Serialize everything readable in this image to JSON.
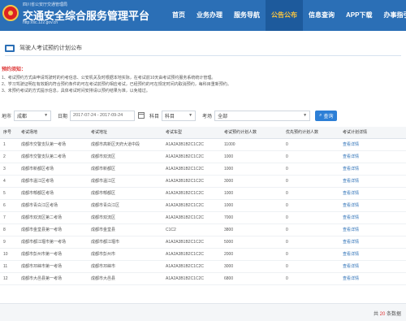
{
  "header": {
    "org_line": "四川省公安厅交通管理局",
    "site_title": "交通安全综合服务管理平台",
    "url": "http://sc.122.gov.cn",
    "nav": [
      "首页",
      "业务办理",
      "服务导航",
      "公告公布",
      "信息查询",
      "APP下载",
      "办事指引"
    ],
    "active_nav_index": 3
  },
  "section": {
    "title": "驾驶人考试预约计划公布"
  },
  "notes": {
    "title": "预约须知：",
    "items": [
      "1、考试预约方式由申请驾驶时的约考信息、公安机关及时根据本地实际，在考试前10天由考试预约服务系统统计管理。",
      "2、学习驾驶证明在有效期内符合预约条件的可在考试前预约相应考试，已经预约的可在规定时间内取消预约，每科目重新预约。",
      "3、未预约考试的方式提示信息，具体考试时间安排请以预约结果为准，以免错过。"
    ]
  },
  "filters": {
    "city_label": "地市",
    "city_value": "成都",
    "date_label": "日期",
    "date_value": "2017-07-24 - 2017-09-24",
    "subject_label": "科目",
    "subject_value": "科目",
    "venue_label": "考场",
    "venue_value": "全部",
    "query_label": "查询"
  },
  "table": {
    "headers": [
      "序号",
      "考试场地",
      "考试地址",
      "考试车型",
      "考试预约计划人数",
      "优先预约计划人数",
      "考试计划详情"
    ],
    "rows": [
      [
        "1",
        "成都市交警支队第一考场",
        "成都市高新区天府大道中段",
        "A1A2A3B1B2C1C2C",
        "11000",
        "0",
        "查看详情"
      ],
      [
        "2",
        "成都市交警支队第二考场",
        "成都市双流区",
        "A1A2A3B1B2C1C2C",
        "1000",
        "0",
        "查看详情"
      ],
      [
        "3",
        "成都市新都区考场",
        "成都市新都区",
        "A1A2A3B1B2C1C2C",
        "1000",
        "0",
        "查看详情"
      ],
      [
        "4",
        "成都市温江区考场",
        "成都市温江区",
        "A1A2A3B1B2C1C2C",
        "3000",
        "0",
        "查看详情"
      ],
      [
        "5",
        "成都市郫都区考场",
        "成都市郫都区",
        "A1A2A3B1B2C1C2C",
        "1000",
        "0",
        "查看详情"
      ],
      [
        "6",
        "成都市青白江区考场",
        "成都市青白江区",
        "A1A2A3B1B2C1C2C",
        "1000",
        "0",
        "查看详情"
      ],
      [
        "7",
        "成都市双流区第二考场",
        "成都市双流区",
        "A1A2A3B1B2C1C2C",
        "7000",
        "0",
        "查看详情"
      ],
      [
        "8",
        "成都市金堂县第一考场",
        "成都市金堂县",
        "C1C2",
        "3800",
        "0",
        "查看详情"
      ],
      [
        "9",
        "成都市都江堰市第一考场",
        "成都市都江堰市",
        "A1A2A3B1B2C1C2C",
        "5000",
        "0",
        "查看详情"
      ],
      [
        "10",
        "成都市彭州市第一考场",
        "成都市彭州市",
        "A1A2A3B1B2C1C2C",
        "2000",
        "0",
        "查看详情"
      ],
      [
        "11",
        "成都市邛崃市第一考场",
        "成都市邛崃市",
        "A1A2A3B1B2C1C2C",
        "3000",
        "0",
        "查看详情"
      ],
      [
        "12",
        "成都市大邑县第一考场",
        "成都市大邑县",
        "A1A2A3B1B2C1C2C",
        "6800",
        "0",
        "查看详情"
      ]
    ]
  },
  "footer": {
    "prefix": "共",
    "count": "20",
    "suffix": "条数据"
  },
  "colors": {
    "header_blue": "#2b6fb6",
    "active_nav": "#f5c342",
    "link": "#2b6fb6",
    "notes_title": "#d33"
  }
}
